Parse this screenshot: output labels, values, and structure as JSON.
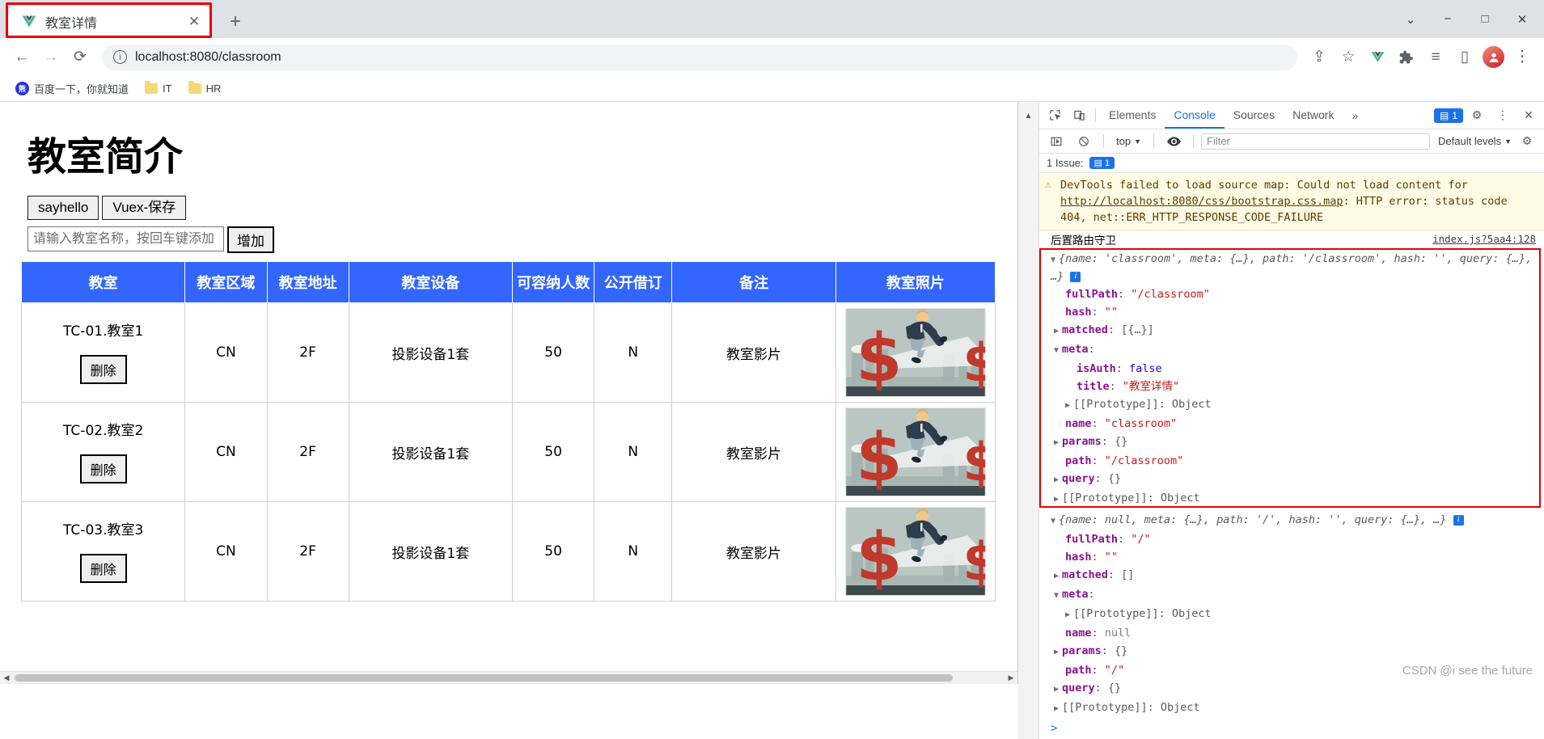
{
  "browser": {
    "tab": {
      "title": "教室详情",
      "favicon": "vue-logo-icon",
      "close_label": "✕"
    },
    "new_tab_label": "+",
    "window_controls": {
      "minimize": "−",
      "maximize": "□",
      "close": "✕",
      "chevron": "⌄"
    },
    "nav": {
      "back": "←",
      "forward": "→",
      "reload": "⟳"
    },
    "omnibox": {
      "info": "ⓘ",
      "url": "localhost:8080/classroom"
    },
    "toolbar_icons": {
      "share": "⇪",
      "bookmark_star": "☆",
      "vue_ext": "V",
      "extensions": "🧩",
      "reading_list": "≡",
      "sidepanel": "▯",
      "menu": "⋮"
    },
    "bookmarks": [
      {
        "icon": "baidu-icon",
        "label": "百度一下，你就知道"
      },
      {
        "icon": "folder-icon",
        "label": "IT"
      },
      {
        "icon": "folder-icon",
        "label": "HR"
      }
    ]
  },
  "page": {
    "title": "教室简介",
    "buttons": {
      "sayhello": "sayhello",
      "vuex_save": "Vuex-保存",
      "add": "增加"
    },
    "input": {
      "placeholder": "请输入教室名称，按回车键添加",
      "value": ""
    },
    "table": {
      "headers": [
        "教室",
        "教室区域",
        "教室地址",
        "教室设备",
        "可容纳人数",
        "公开借订",
        "备注",
        "教室照片"
      ],
      "delete_label": "删除",
      "rows": [
        {
          "classroom": "TC-01.教室1",
          "area": "CN",
          "address": "2F",
          "equipment": "投影设备1套",
          "capacity": "50",
          "public": "N",
          "remark": "教室影片",
          "photo_alt": "businessman-jumping-dollar-illustration"
        },
        {
          "classroom": "TC-02.教室2",
          "area": "CN",
          "address": "2F",
          "equipment": "投影设备1套",
          "capacity": "50",
          "public": "N",
          "remark": "教室影片",
          "photo_alt": "businessman-jumping-dollar-illustration"
        },
        {
          "classroom": "TC-03.教室3",
          "area": "CN",
          "address": "2F",
          "equipment": "投影设备1套",
          "capacity": "50",
          "public": "N",
          "remark": "教室影片",
          "photo_alt": "businessman-jumping-dollar-illustration"
        }
      ]
    },
    "scrollbar": {
      "left_arrow": "◀",
      "right_arrow": "▶"
    }
  },
  "devtools": {
    "tabs": [
      {
        "label": "Elements",
        "active": false
      },
      {
        "label": "Console",
        "active": true
      },
      {
        "label": "Sources",
        "active": false
      },
      {
        "label": "Network",
        "active": false
      }
    ],
    "more_tabs": "»",
    "issues_badge": "1",
    "settings_icon": "⚙",
    "menu_icon": "⋮",
    "close_icon": "✕",
    "inspect_icon": "⌖",
    "device_icon": "▭",
    "toolbar2": {
      "execute_icon": "▶",
      "clear_icon": "⃠",
      "context": "top",
      "eye_icon": "👁",
      "filter_placeholder": "Filter",
      "levels": "Default levels"
    },
    "issue_bar": {
      "text": "1 Issue:",
      "count": "1"
    },
    "console": {
      "warning": "DevTools failed to load source map: Could not load content for http://localhost:8080/css/bootstrap.css.map: HTTP error: status code 404, net::ERR_HTTP_RESPONSE_CODE_FAILURE",
      "warning_link": "http://localhost:8080/css/bootstrap.css.map",
      "log_label": "后置路由守卫",
      "source_ref": "index.js?5aa4:128",
      "entry1": {
        "summary": "{name: 'classroom', meta: {…}, path: '/classroom', hash: '', query: {…}, …}",
        "fullPath": "\"/classroom\"",
        "hash": "\"\"",
        "matched": "[{…}]",
        "meta_isAuth": "false",
        "meta_title": "\"教室详情\"",
        "prototype": "[[Prototype]]: Object",
        "name": "\"classroom\"",
        "params": "{}",
        "path": "\"/classroom\"",
        "query": "{}"
      },
      "entry2": {
        "summary": "{name: null, meta: {…}, path: '/', hash: '', query: {…}, …}",
        "fullPath": "\"/\"",
        "hash": "\"\"",
        "matched": "[]",
        "meta_prototype": "[[Prototype]]: Object",
        "name": "null",
        "params": "{}",
        "path": "\"/\"",
        "query": "{}",
        "prototype": "[[Prototype]]: Object"
      },
      "prompt": ">"
    }
  },
  "watermark": "CSDN @i see the future",
  "colors": {
    "table_header": "#3366ff",
    "link": "#3a7bd5",
    "accent": "#1a73e8",
    "highlight_box": "#e60000"
  }
}
